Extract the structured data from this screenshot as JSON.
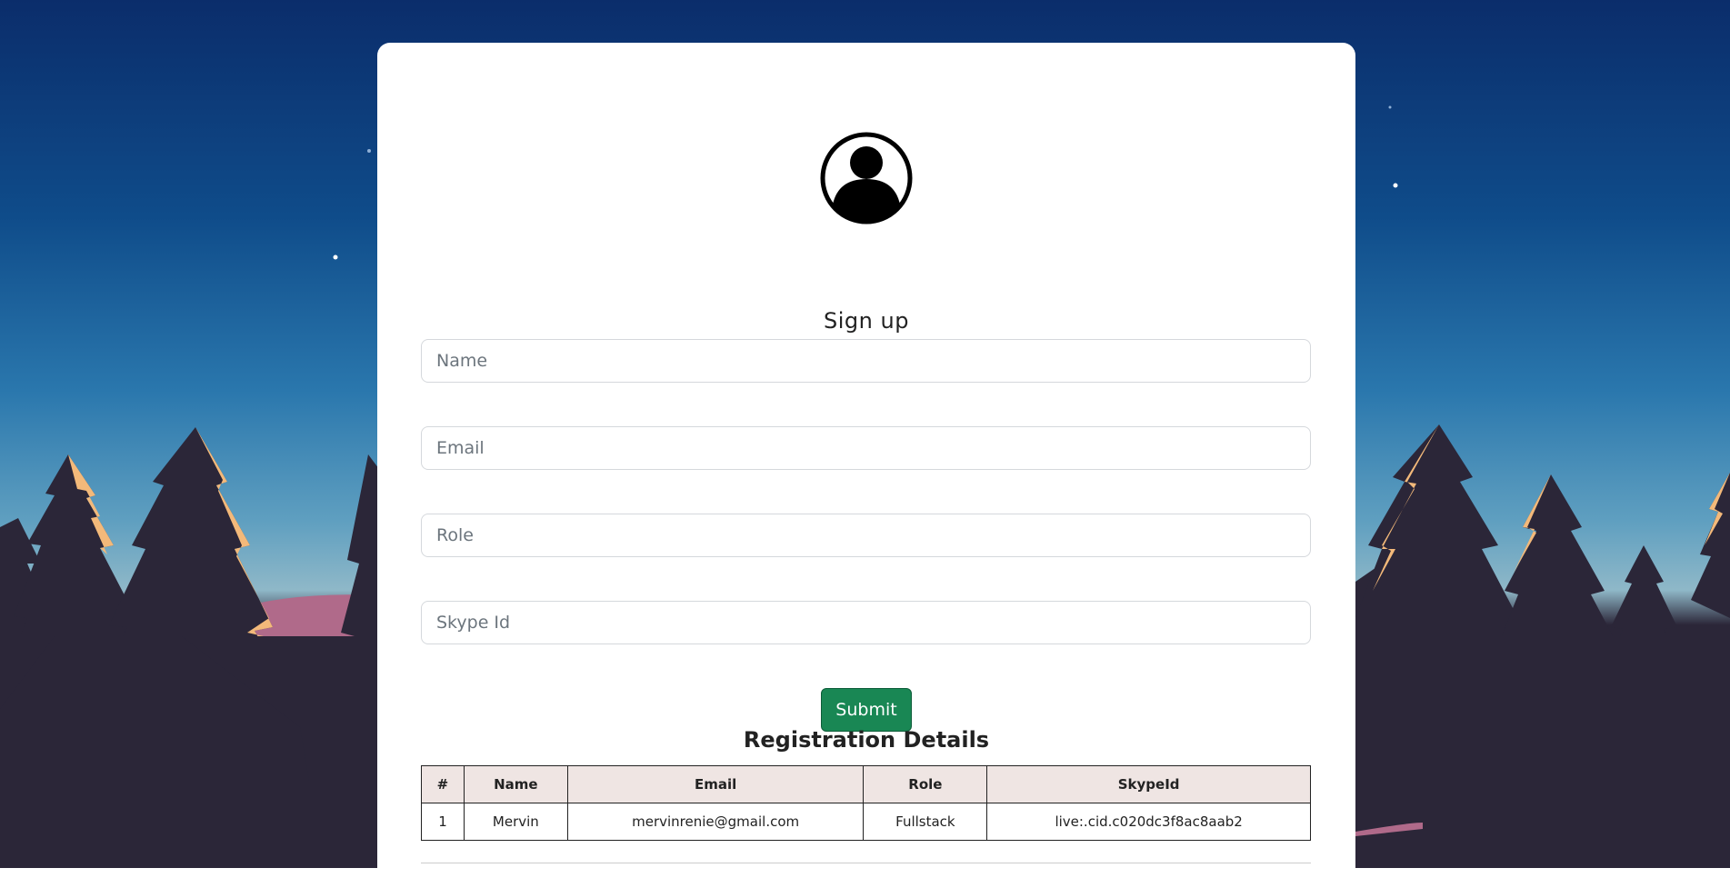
{
  "form": {
    "title": "Sign up",
    "fields": [
      {
        "name": "name",
        "placeholder": "Name",
        "value": ""
      },
      {
        "name": "email",
        "placeholder": "Email",
        "value": ""
      },
      {
        "name": "role",
        "placeholder": "Role",
        "value": ""
      },
      {
        "name": "skype",
        "placeholder": "Skype Id",
        "value": ""
      }
    ],
    "submit_label": "Submit"
  },
  "registration": {
    "title": "Registration Details",
    "columns": [
      "#",
      "Name",
      "Email",
      "Role",
      "SkypeId"
    ],
    "rows": [
      [
        "1",
        "Mervin",
        "mervinrenie@gmail.com",
        "Fullstack",
        "live:.cid.c020dc3f8ac8aab2"
      ]
    ]
  },
  "colors": {
    "submit_bg": "#198754",
    "header_bg": "#efe5e3",
    "sky_top": "#0b2d6b",
    "trees": "#2b2638"
  },
  "icons": {
    "avatar": "user-circle-icon"
  }
}
